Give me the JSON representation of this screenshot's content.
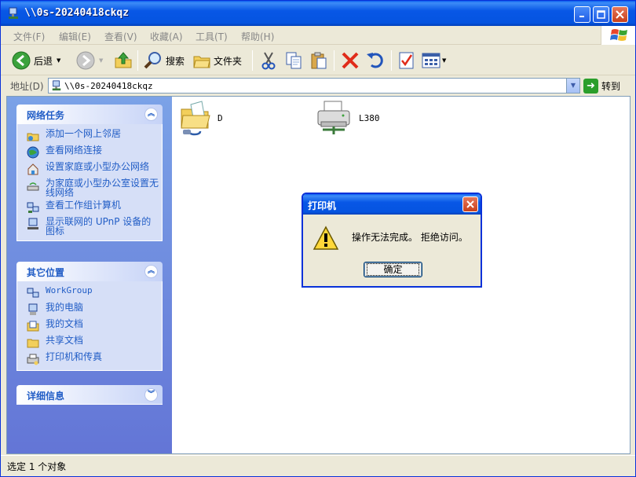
{
  "window": {
    "title": "\\\\0s-20240418ckqz"
  },
  "menu": [
    "文件(F)",
    "编辑(E)",
    "查看(V)",
    "收藏(A)",
    "工具(T)",
    "帮助(H)"
  ],
  "toolbar": {
    "back_label": "后退",
    "search_label": "搜索",
    "folders_label": "文件夹"
  },
  "address": {
    "label": "地址(D)",
    "value": "\\\\0s-20240418ckqz",
    "go_label": "转到"
  },
  "network_tasks": {
    "title": "网络任务",
    "items": [
      {
        "label": "添加一个网上邻居",
        "icon": "add-network-place-icon"
      },
      {
        "label": "查看网络连接",
        "icon": "network-connections-icon"
      },
      {
        "label": "设置家庭或小型办公网络",
        "icon": "home-network-icon"
      },
      {
        "label": "为家庭或小型办公室设置无线网络",
        "icon": "wireless-network-icon"
      },
      {
        "label": "查看工作组计算机",
        "icon": "workgroup-computers-icon"
      },
      {
        "label": "显示联网的 UPnP 设备的图标",
        "icon": "upnp-device-icon"
      }
    ]
  },
  "other_places": {
    "title": "其它位置",
    "items": [
      {
        "label": "WorkGroup",
        "icon": "workgroup-icon"
      },
      {
        "label": "我的电脑",
        "icon": "my-computer-icon"
      },
      {
        "label": "我的文档",
        "icon": "my-documents-icon"
      },
      {
        "label": "共享文档",
        "icon": "shared-documents-icon"
      },
      {
        "label": "打印机和传真",
        "icon": "printers-faxes-icon"
      }
    ]
  },
  "details": {
    "title": "详细信息"
  },
  "files": [
    {
      "name": "D",
      "icon": "shared-folder-icon"
    },
    {
      "name": "L380",
      "icon": "shared-printer-icon"
    }
  ],
  "status": {
    "text": "选定 1 个对象"
  },
  "dialog": {
    "title": "打印机",
    "message": "操作无法完成。 拒绝访问。",
    "ok_label": "确定",
    "icon": "warning-icon"
  }
}
